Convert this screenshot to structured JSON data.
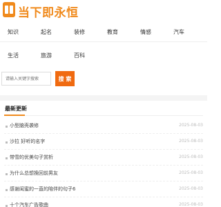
{
  "header": {
    "logo_icon": "book-icon",
    "logo_text": "当下即永恒",
    "brand_color": "#f08a1c"
  },
  "nav": {
    "items": [
      {
        "label": "知识"
      },
      {
        "label": "起名"
      },
      {
        "label": "装修"
      },
      {
        "label": "教育"
      },
      {
        "label": "情感"
      },
      {
        "label": "汽车"
      },
      {
        "label": "生活"
      },
      {
        "label": "旅游"
      },
      {
        "label": "百科"
      }
    ]
  },
  "search": {
    "placeholder": "请输入关键字搜索",
    "button_label": "搜 索",
    "button_color": "#f06a10"
  },
  "latest": {
    "title": "最新更新",
    "items": [
      {
        "title": "小型脑壳袭修",
        "date": "2025-08-03"
      },
      {
        "title": "沙拉 好听的名字",
        "date": "2025-08-03"
      },
      {
        "title": "带雪的优美句子赏析",
        "date": "2025-08-03"
      },
      {
        "title": "为什么总想挽回前男友",
        "date": "2025-08-03"
      },
      {
        "title": "感谢闺蜜的一直的陪伴的句子6",
        "date": "2025-08-03"
      },
      {
        "title": "十个汽车广告歌曲",
        "date": "2025-08-03"
      }
    ]
  }
}
